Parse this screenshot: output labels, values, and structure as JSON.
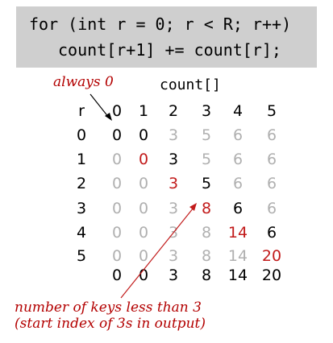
{
  "code": {
    "line1": "for (int r = 0; r < R; r++)",
    "line2": "count[r+1] += count[r];"
  },
  "annotations": {
    "always_zero": "always 0",
    "keys_line1": "number of keys less than 3",
    "keys_line2": "(start index of 3s in output)"
  },
  "array_label": "count[]",
  "table": {
    "row_header_label": "r",
    "column_headers": [
      "0",
      "1",
      "2",
      "3",
      "4",
      "5"
    ],
    "rows": [
      {
        "r": "0",
        "cells": [
          {
            "v": "0",
            "c": "black"
          },
          {
            "v": "0",
            "c": "black"
          },
          {
            "v": "3",
            "c": "gray"
          },
          {
            "v": "5",
            "c": "gray"
          },
          {
            "v": "6",
            "c": "gray"
          },
          {
            "v": "6",
            "c": "gray"
          }
        ]
      },
      {
        "r": "1",
        "cells": [
          {
            "v": "0",
            "c": "gray"
          },
          {
            "v": "0",
            "c": "red"
          },
          {
            "v": "3",
            "c": "black"
          },
          {
            "v": "5",
            "c": "gray"
          },
          {
            "v": "6",
            "c": "gray"
          },
          {
            "v": "6",
            "c": "gray"
          }
        ]
      },
      {
        "r": "2",
        "cells": [
          {
            "v": "0",
            "c": "gray"
          },
          {
            "v": "0",
            "c": "gray"
          },
          {
            "v": "3",
            "c": "red"
          },
          {
            "v": "5",
            "c": "black"
          },
          {
            "v": "6",
            "c": "gray"
          },
          {
            "v": "6",
            "c": "gray"
          }
        ]
      },
      {
        "r": "3",
        "cells": [
          {
            "v": "0",
            "c": "gray"
          },
          {
            "v": "0",
            "c": "gray"
          },
          {
            "v": "3",
            "c": "gray"
          },
          {
            "v": "8",
            "c": "red"
          },
          {
            "v": "6",
            "c": "black"
          },
          {
            "v": "6",
            "c": "gray"
          }
        ]
      },
      {
        "r": "4",
        "cells": [
          {
            "v": "0",
            "c": "gray"
          },
          {
            "v": "0",
            "c": "gray"
          },
          {
            "v": "3",
            "c": "gray"
          },
          {
            "v": "8",
            "c": "gray"
          },
          {
            "v": "14",
            "c": "red"
          },
          {
            "v": "6",
            "c": "black"
          }
        ]
      },
      {
        "r": "5",
        "cells": [
          {
            "v": "0",
            "c": "gray"
          },
          {
            "v": "0",
            "c": "gray"
          },
          {
            "v": "3",
            "c": "gray"
          },
          {
            "v": "8",
            "c": "gray"
          },
          {
            "v": "14",
            "c": "gray"
          },
          {
            "v": "20",
            "c": "red"
          }
        ]
      }
    ],
    "final_row": [
      "0",
      "0",
      "3",
      "8",
      "14",
      "20"
    ]
  },
  "colors": {
    "code_background": "#cfcfcf",
    "red": "#c21b1b",
    "gray": "#b0b0b0",
    "black": "#000000"
  }
}
